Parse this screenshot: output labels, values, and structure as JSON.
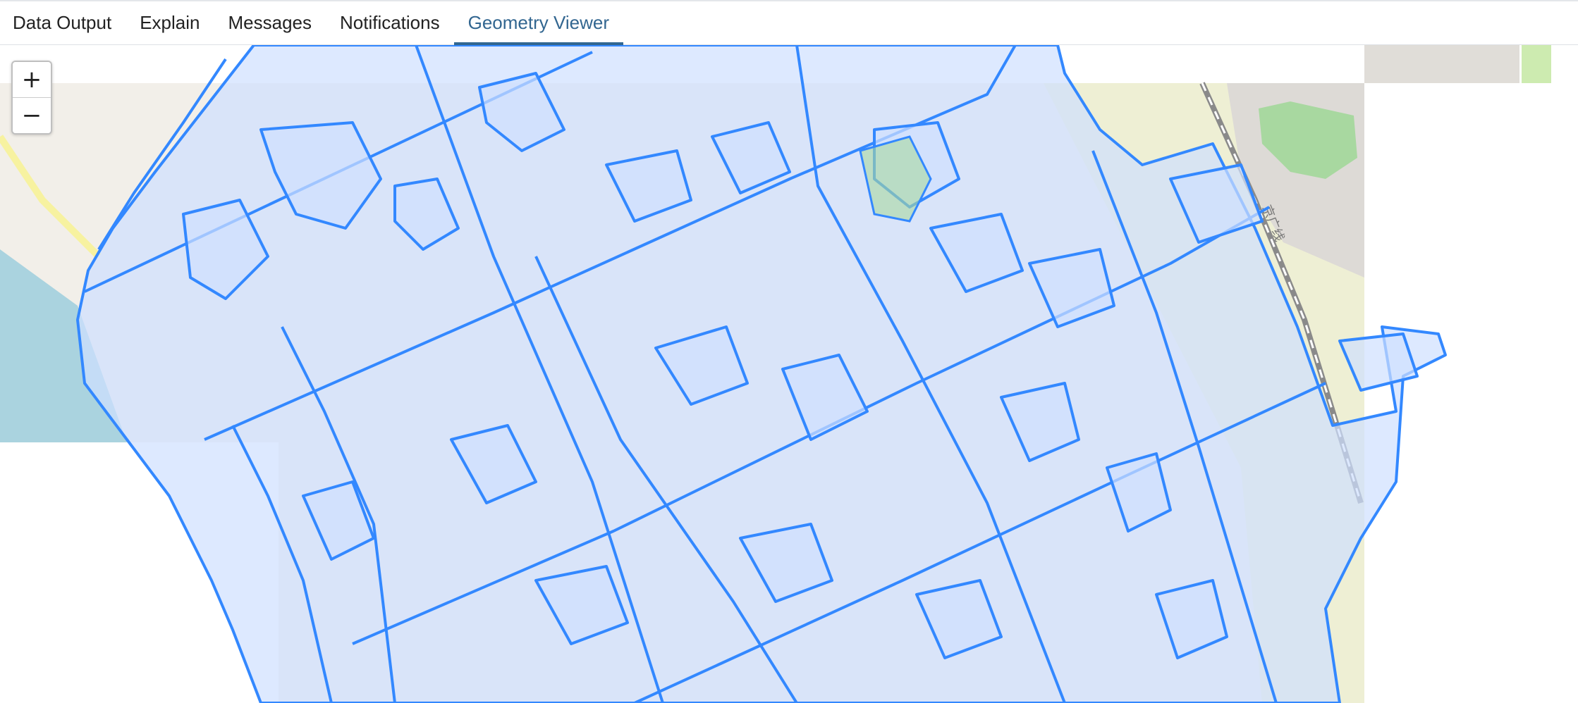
{
  "tabs": [
    {
      "label": "Data Output",
      "active": false
    },
    {
      "label": "Explain",
      "active": false
    },
    {
      "label": "Messages",
      "active": false
    },
    {
      "label": "Notifications",
      "active": false
    },
    {
      "label": "Geometry Viewer",
      "active": true
    }
  ],
  "map": {
    "zoom_in_label": "+",
    "zoom_out_label": "−",
    "rail_label": "京广线",
    "colors": {
      "accent": "#326690",
      "polygon_stroke": "#3388ff",
      "polygon_fill": "#cfe0ff",
      "water": "#aad3df",
      "park": "#a8d8a0",
      "land": "#f2efe9"
    }
  }
}
